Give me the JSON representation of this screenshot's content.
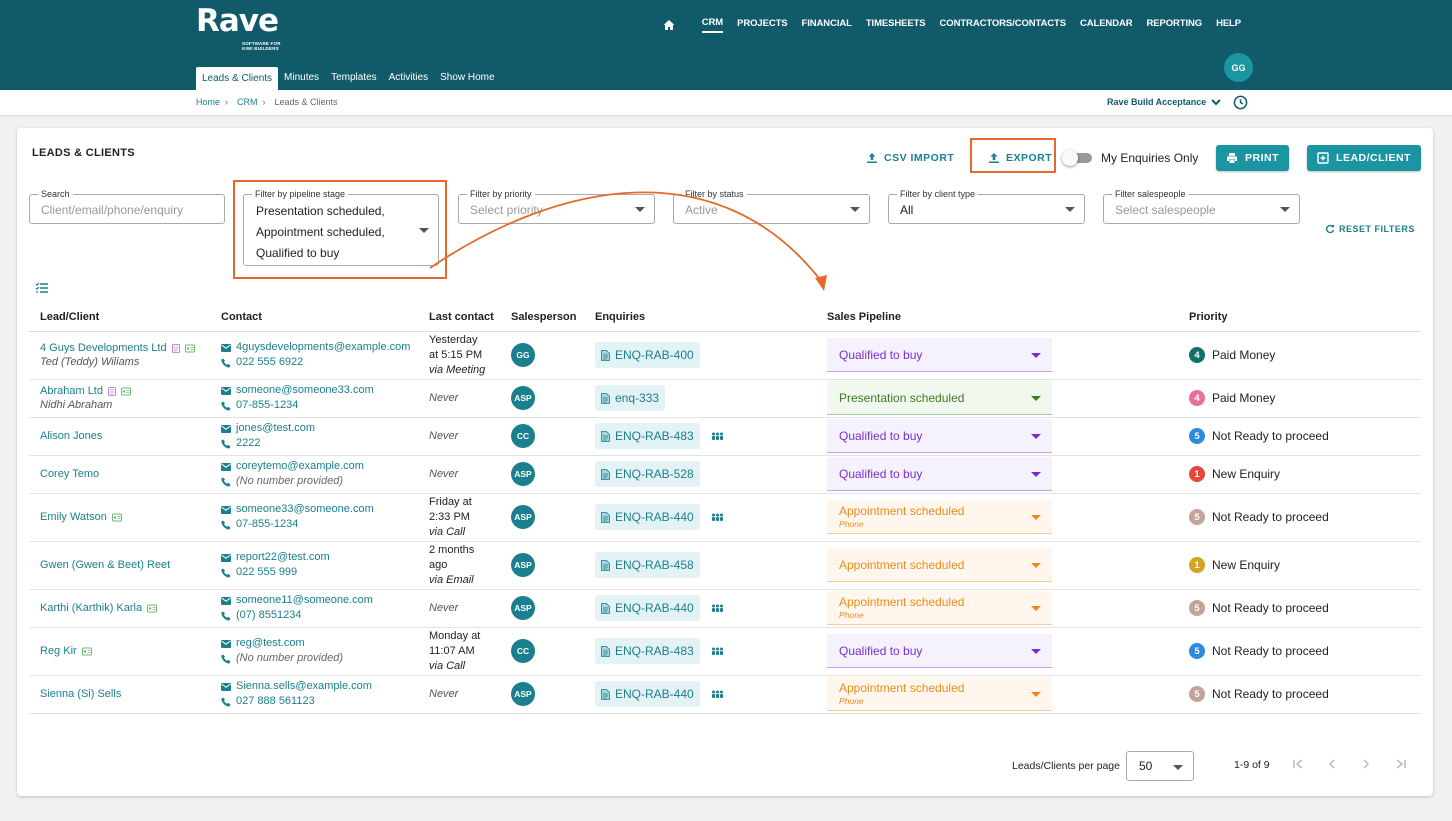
{
  "app": {
    "logo": "Rave",
    "tagline": "SOFTWARE FOR KIWI BUILDERS"
  },
  "mainnav": [
    "CRM",
    "PROJECTS",
    "FINANCIAL",
    "TIMESHEETS",
    "CONTRACTORS/CONTACTS",
    "CALENDAR",
    "REPORTING",
    "HELP"
  ],
  "subnav": [
    "Leads & Clients",
    "Minutes",
    "Templates",
    "Activities",
    "Show Home"
  ],
  "user": {
    "initials": "GG"
  },
  "breadcrumb": [
    "Home",
    "CRM",
    "Leads & Clients"
  ],
  "company": "Rave Build Acceptance",
  "page": {
    "title": "LEADS & CLIENTS"
  },
  "actions": {
    "csv_import": "CSV IMPORT",
    "export": "EXPORT",
    "my_enquiries": "My Enquiries Only",
    "print": "PRINT",
    "add": "LEAD/CLIENT"
  },
  "filters": {
    "search": {
      "label": "Search",
      "placeholder": "Client/email/phone/enquiry"
    },
    "pipeline": {
      "label": "Filter by pipeline stage",
      "values": [
        "Presentation scheduled,",
        "Appointment scheduled,",
        "Qualified to buy"
      ]
    },
    "priority": {
      "label": "Filter by priority",
      "placeholder": "Select priority"
    },
    "status": {
      "label": "Filter by status",
      "placeholder": "Active"
    },
    "client_type": {
      "label": "Filter by client type",
      "value": "All"
    },
    "salespeople": {
      "label": "Filter salespeople",
      "placeholder": "Select salespeople"
    },
    "reset": "RESET FILTERS"
  },
  "columns": [
    "Lead/Client",
    "Contact",
    "Last contact",
    "Salesperson",
    "Enquiries",
    "Sales Pipeline",
    "Priority"
  ],
  "rows": [
    {
      "name": "4 Guys Developments Ltd",
      "sub": "Ted (Teddy) Wiliams",
      "icons": [
        "doc",
        "card"
      ],
      "email": "4guysdevelopments@example.com",
      "phone": "022 555 6922",
      "phone_none": false,
      "last": [
        "Yesterday",
        "at 5:15 PM"
      ],
      "via": "via Meeting",
      "sp": "GG",
      "enq": "ENQ-RAB-400",
      "people": false,
      "pipe": "Qualified to buy",
      "pipe_note": "",
      "pipe_kind": "q",
      "pri": "4",
      "pri_label": "Paid Money",
      "pri_color": "#11726a"
    },
    {
      "name": "Abraham Ltd",
      "sub": "Nidhi Abraham",
      "icons": [
        "doc",
        "card"
      ],
      "email": "someone@someone33.com",
      "phone": "07-855-1234",
      "phone_none": false,
      "last": [],
      "via": "Never",
      "sp": "ASP",
      "enq": "enq-333",
      "people": false,
      "pipe": "Presentation scheduled",
      "pipe_note": "",
      "pipe_kind": "p",
      "pri": "4",
      "pri_label": "Paid Money",
      "pri_color": "#e96fa0"
    },
    {
      "name": "Alison Jones",
      "sub": "",
      "icons": [],
      "email": "jones@test.com",
      "phone": "2222",
      "phone_none": false,
      "last": [],
      "via": "Never",
      "sp": "CC",
      "enq": "ENQ-RAB-483",
      "people": true,
      "pipe": "Qualified to buy",
      "pipe_note": "",
      "pipe_kind": "q",
      "pri": "5",
      "pri_label": "Not Ready to proceed",
      "pri_color": "#2d8ae0"
    },
    {
      "name": "Corey Temo",
      "sub": "",
      "icons": [],
      "email": "coreytemo@example.com",
      "phone": "(No number provided)",
      "phone_none": true,
      "last": [],
      "via": "Never",
      "sp": "ASP",
      "enq": "ENQ-RAB-528",
      "people": false,
      "pipe": "Qualified to buy",
      "pipe_note": "",
      "pipe_kind": "q",
      "pri": "1",
      "pri_label": "New Enquiry",
      "pri_color": "#e5483b"
    },
    {
      "name": "Emily Watson",
      "sub": "",
      "icons": [
        "card"
      ],
      "email": "someone33@someone.com",
      "phone": "07-855-1234",
      "phone_none": false,
      "last": [
        "Friday at",
        "2:33 PM"
      ],
      "via": "via Call",
      "sp": "ASP",
      "enq": "ENQ-RAB-440",
      "people": true,
      "pipe": "Appointment scheduled",
      "pipe_note": "Phone",
      "pipe_kind": "a",
      "pri": "5",
      "pri_label": "Not Ready to proceed",
      "pri_color": "#c4a499"
    },
    {
      "name": "Gwen (Gwen & Beet) Reet",
      "sub": "",
      "icons": [],
      "email": "report22@test.com",
      "phone": "022 555 999",
      "phone_none": false,
      "last": [
        "2 months",
        "ago"
      ],
      "via": "via Email",
      "sp": "ASP",
      "enq": "ENQ-RAB-458",
      "people": false,
      "pipe": "Appointment scheduled",
      "pipe_note": "",
      "pipe_kind": "a",
      "pri": "1",
      "pri_label": "New Enquiry",
      "pri_color": "#d2a41f"
    },
    {
      "name": "Karthi (Karthik) Karla",
      "sub": "",
      "icons": [
        "card"
      ],
      "email": "someone11@someone.com",
      "phone": "(07) 8551234",
      "phone_none": false,
      "last": [],
      "via": "Never",
      "sp": "ASP",
      "enq": "ENQ-RAB-440",
      "people": true,
      "pipe": "Appointment scheduled",
      "pipe_note": "Phone",
      "pipe_kind": "a",
      "pri": "5",
      "pri_label": "Not Ready to proceed",
      "pri_color": "#c4a499"
    },
    {
      "name": "Reg Kir",
      "sub": "",
      "icons": [
        "card"
      ],
      "email": "reg@test.com",
      "phone": "(No number provided)",
      "phone_none": true,
      "last": [
        "Monday at",
        "11:07 AM"
      ],
      "via": "via Call",
      "sp": "CC",
      "enq": "ENQ-RAB-483",
      "people": true,
      "pipe": "Qualified to buy",
      "pipe_note": "",
      "pipe_kind": "q",
      "pri": "5",
      "pri_label": "Not Ready to proceed",
      "pri_color": "#2d8ae0"
    },
    {
      "name": "Sienna (Si) Sells",
      "sub": "",
      "icons": [],
      "email": "Sienna.sells@example.com",
      "phone": "027 888 561123",
      "phone_none": false,
      "last": [],
      "via": "Never",
      "sp": "ASP",
      "enq": "ENQ-RAB-440",
      "people": true,
      "pipe": "Appointment scheduled",
      "pipe_note": "Phone",
      "pipe_kind": "a",
      "pri": "5",
      "pri_label": "Not Ready to proceed",
      "pri_color": "#c4a499"
    }
  ],
  "pipeline_styles": {
    "q": {
      "bg": "#f6f2fd",
      "fg": "#7b2ec9"
    },
    "p": {
      "bg": "#f1f8ee",
      "fg": "#3f7a26"
    },
    "a": {
      "bg": "#fff7ee",
      "fg": "#ec8b1c"
    }
  },
  "pagination": {
    "per_page_label": "Leads/Clients per page",
    "per_page": "50",
    "range": "1-9 of 9"
  },
  "colors": {
    "brand": "#105a6a",
    "accent": "#1a95a1",
    "highlight": "#e4692a"
  }
}
